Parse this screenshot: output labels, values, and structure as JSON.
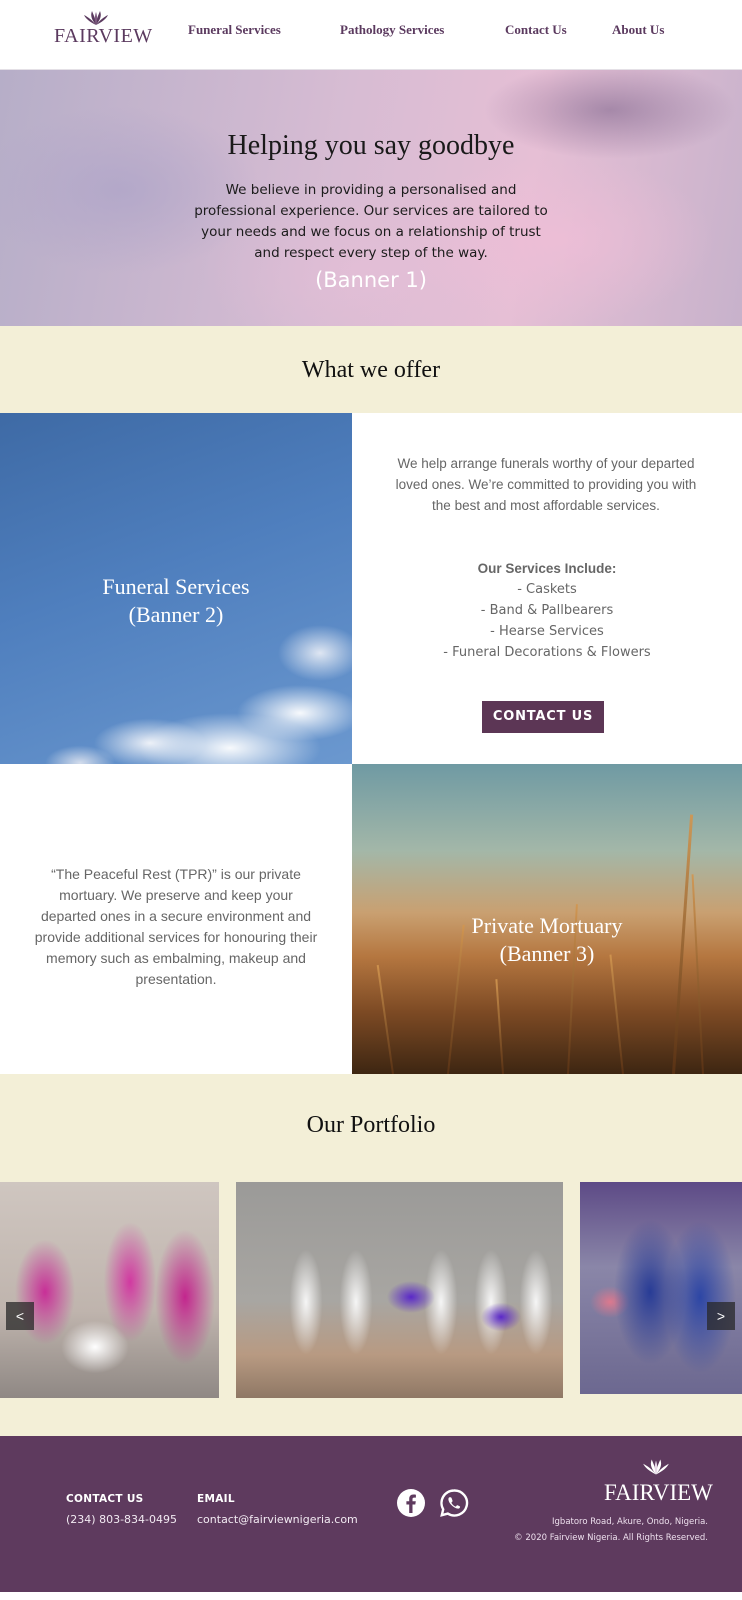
{
  "brand": {
    "name": "FAIRVIEW",
    "color": "#5b3a5f"
  },
  "nav": {
    "items": [
      {
        "label": "Funeral Services"
      },
      {
        "label": "Pathology Services"
      },
      {
        "label": "Contact Us"
      },
      {
        "label": "About Us"
      }
    ]
  },
  "hero": {
    "title": "Helping you say goodbye",
    "text": "We believe in providing a personalised and professional experience. Our services are tailored to your needs and we focus on a relationship of trust and respect every step of the way.",
    "banner": "(Banner 1)"
  },
  "offer": {
    "heading": "What we offer",
    "funeral": {
      "banner_line1": "Funeral Services",
      "banner_line2": "(Banner 2)",
      "description": "We help arrange funerals worthy of your departed loved ones. We’re committed to providing you with the best and most affordable services.",
      "includes_title": "Our Services Include:",
      "items": [
        "- Caskets",
        "- Band & Pallbearers",
        "- Hearse Services",
        "- Funeral Decorations & Flowers"
      ],
      "button_label": "CONTACT US"
    },
    "mortuary": {
      "description": "“The Peaceful Rest (TPR)” is our private mortuary. We preserve and keep your departed ones in a secure environment and provide additional services for honouring their memory such as embalming, makeup and presentation.",
      "banner_line1": "Private Mortuary",
      "banner_line2": "(Banner 3)"
    }
  },
  "portfolio": {
    "heading": "Our Portfolio",
    "prev_label": "<",
    "next_label": ">"
  },
  "footer": {
    "contact_label": "CONTACT US",
    "phone": "(234) 803-834-0495",
    "email_label": "EMAIL",
    "email": "contact@fairviewnigeria.com",
    "social": [
      "facebook-icon",
      "whatsapp-icon"
    ],
    "logo_text": "FAIRVIEW",
    "address": "Igbatoro Road, Akure, Ondo, Nigeria.",
    "copyright": "© 2020 Fairview Nigeria. All Rights Reserved."
  },
  "colors": {
    "accent": "#5c3655",
    "band_background": "#f3efd7",
    "footer_background": "#5e3a5e"
  }
}
